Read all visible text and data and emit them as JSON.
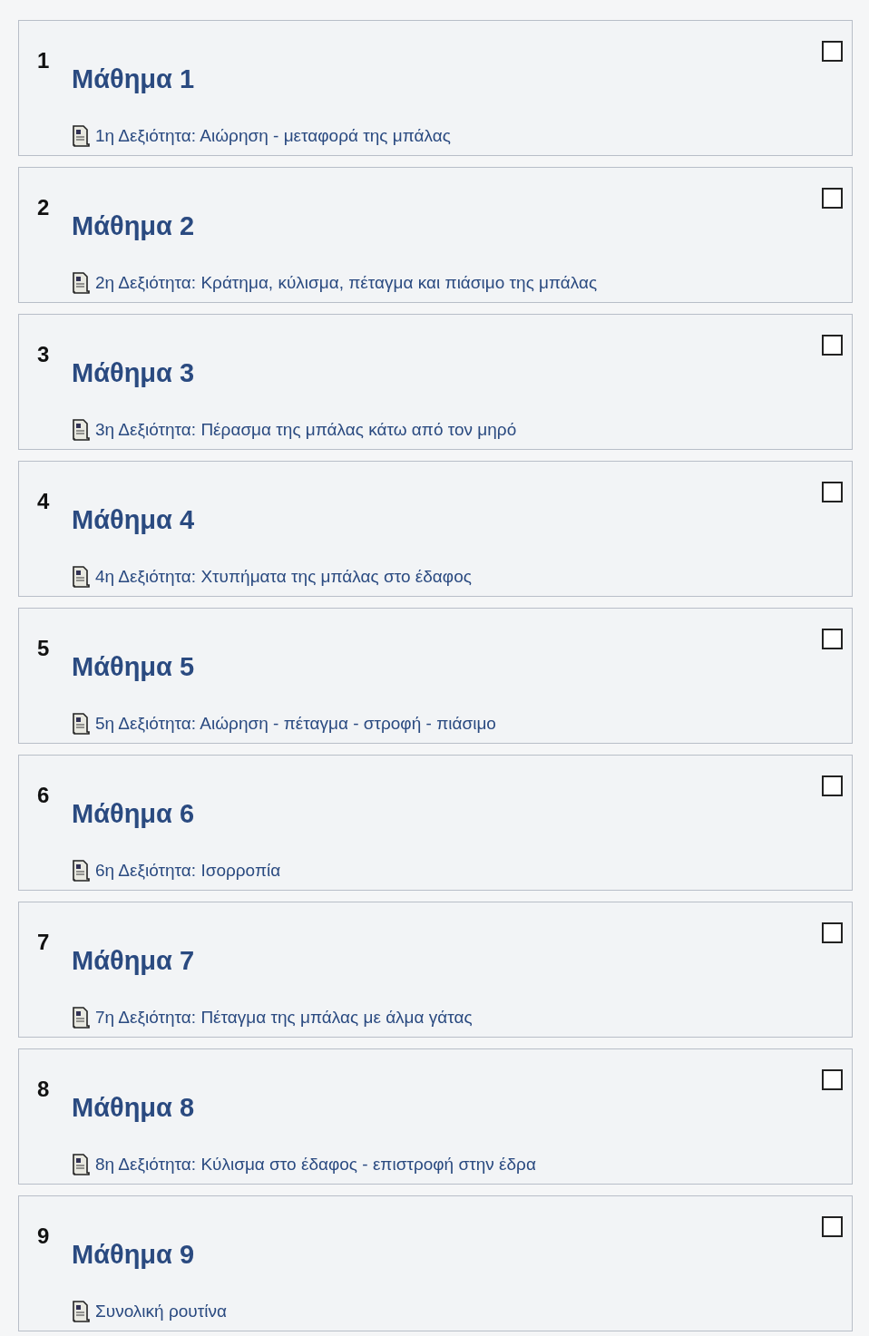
{
  "sections": [
    {
      "number": "1",
      "title": "Μάθημα 1",
      "activity": "1η Δεξιότητα: Αιώρηση - μεταφορά της μπάλας",
      "checked": false
    },
    {
      "number": "2",
      "title": "Μάθημα 2",
      "activity": "2η Δεξιότητα: Κράτημα, κύλισμα, πέταγμα και πιάσιμο της μπάλας",
      "checked": false
    },
    {
      "number": "3",
      "title": "Μάθημα 3",
      "activity": "3η Δεξιότητα: Πέρασμα της μπάλας κάτω από τον μηρό",
      "checked": false
    },
    {
      "number": "4",
      "title": "Μάθημα 4",
      "activity": "4η Δεξιότητα: Χτυπήματα της μπάλας στο έδαφος",
      "checked": false
    },
    {
      "number": "5",
      "title": "Μάθημα 5",
      "activity": "5η Δεξιότητα: Αιώρηση - πέταγμα - στροφή - πιάσιμο",
      "checked": false
    },
    {
      "number": "6",
      "title": "Μάθημα 6",
      "activity": "6η Δεξιότητα: Ισορροπία",
      "checked": false
    },
    {
      "number": "7",
      "title": "Μάθημα 7",
      "activity": "7η Δεξιότητα: Πέταγμα της μπάλας με άλμα γάτας",
      "checked": false
    },
    {
      "number": "8",
      "title": "Μάθημα 8",
      "activity": "8η Δεξιότητα: Κύλισμα στο έδαφος - επιστροφή στην έδρα",
      "checked": false
    },
    {
      "number": "9",
      "title": "Μάθημα 9",
      "activity": "Συνολική ρουτίνα",
      "checked": false
    }
  ]
}
